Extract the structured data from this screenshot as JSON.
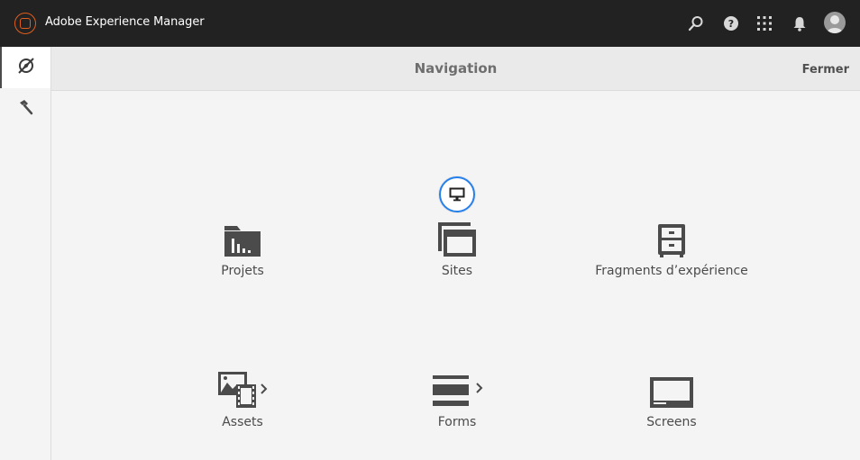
{
  "app": {
    "title": "Adobe Experience Manager"
  },
  "header": {
    "title": "Navigation",
    "close_label": "Fermer"
  },
  "rail": {
    "items": [
      {
        "name": "navigation",
        "icon": "compass-icon"
      },
      {
        "name": "tools",
        "icon": "hammer-icon"
      }
    ]
  },
  "topbar_icons": [
    "search-icon",
    "help-icon",
    "apps-grid-icon",
    "bell-icon",
    "avatar"
  ],
  "tiles": [
    {
      "label": "Projets",
      "icon": "projects-folder-icon",
      "has_arrow": false
    },
    {
      "label": "Sites",
      "icon": "sites-icon",
      "has_arrow": false,
      "badge_icon": "monitor-icon"
    },
    {
      "label": "Fragments d’expérience",
      "icon": "cabinet-icon",
      "has_arrow": false
    },
    {
      "label": "Assets",
      "icon": "assets-icon",
      "has_arrow": true
    },
    {
      "label": "Forms",
      "icon": "forms-icon",
      "has_arrow": true
    },
    {
      "label": "Screens",
      "icon": "screens-icon",
      "has_arrow": false
    }
  ],
  "colors": {
    "topbar": "#222222",
    "accent": "#e05e1e",
    "focus": "#2680eb",
    "icon": "#4b4b4b"
  }
}
